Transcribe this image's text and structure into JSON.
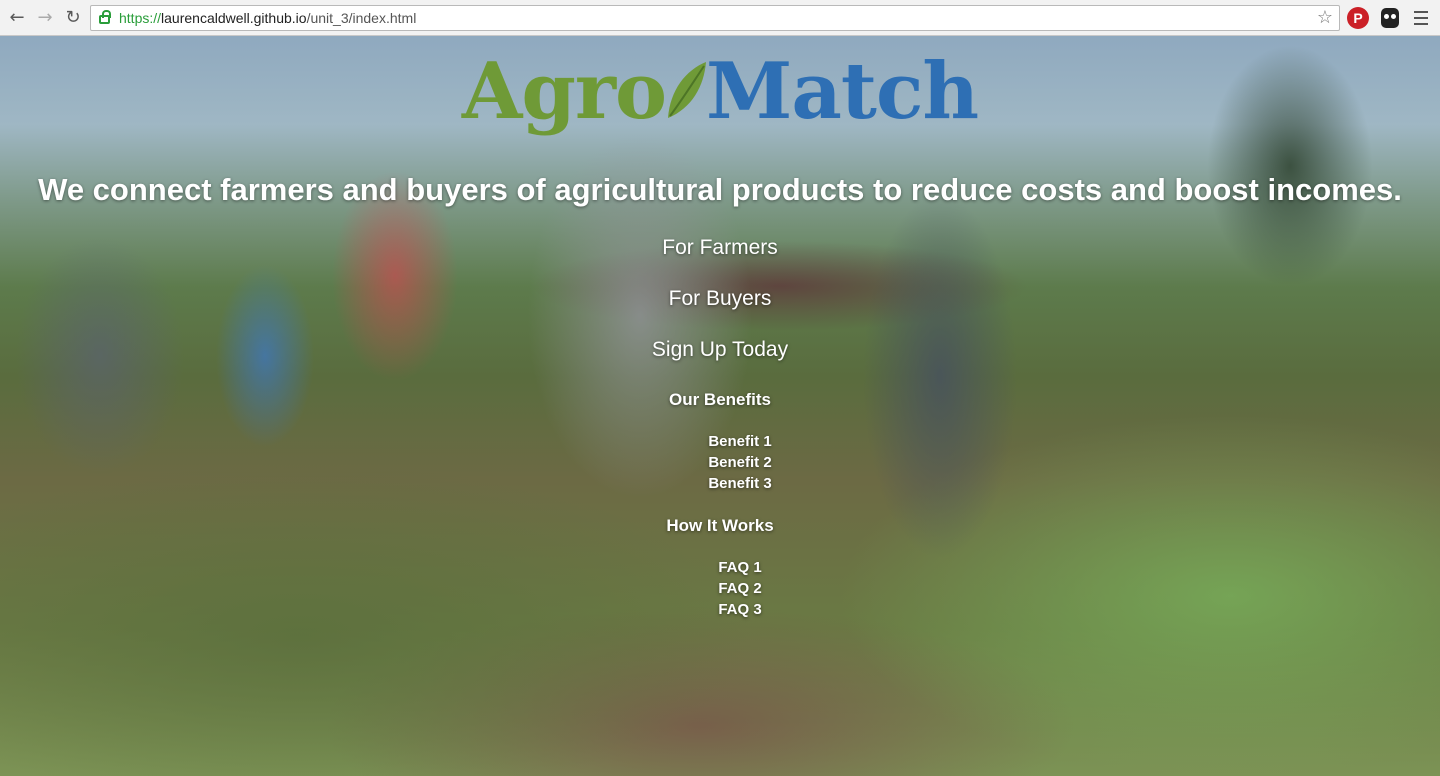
{
  "browser": {
    "url_scheme": "https://",
    "url_host": "laurencaldwell.github.io",
    "url_path": "/unit_3/index.html",
    "pinterest_glyph": "P"
  },
  "logo": {
    "part1": "Agro",
    "part2": "Match",
    "color_agro": "#6f9a37",
    "color_match": "#2e6fb4"
  },
  "tagline": "We connect farmers and buyers of agricultural products to reduce costs and boost incomes.",
  "nav": {
    "for_farmers": "For Farmers",
    "for_buyers": "For Buyers",
    "sign_up": "Sign Up Today"
  },
  "benefits": {
    "heading": "Our Benefits",
    "items": [
      "Benefit 1",
      "Benefit 2",
      "Benefit 3"
    ]
  },
  "how_it_works": {
    "heading": "How It Works",
    "items": [
      "FAQ 1",
      "FAQ 2",
      "FAQ 3"
    ]
  }
}
